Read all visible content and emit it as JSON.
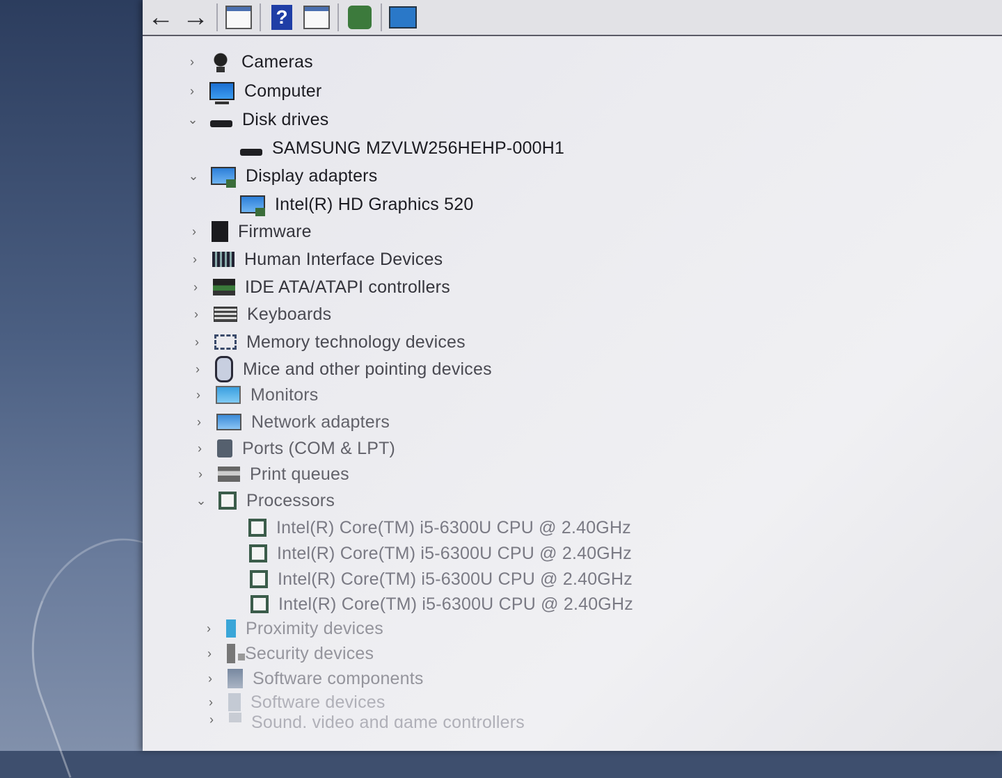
{
  "toolbar": {
    "buttons": [
      {
        "name": "back-arrow-icon",
        "glyph": "←"
      },
      {
        "name": "forward-arrow-icon",
        "glyph": "→"
      },
      {
        "name": "properties-window-icon",
        "glyph": ""
      },
      {
        "name": "help-icon",
        "glyph": "?"
      },
      {
        "name": "details-view-icon",
        "glyph": ""
      },
      {
        "name": "update-driver-icon",
        "glyph": ""
      },
      {
        "name": "scan-hardware-monitor-icon",
        "glyph": ""
      }
    ]
  },
  "tree": {
    "cameras": {
      "label": "Cameras",
      "chevron": "›",
      "icon": "camera-icon"
    },
    "computer": {
      "label": "Computer",
      "chevron": "›",
      "icon": "computer-icon"
    },
    "disk_drives": {
      "label": "Disk drives",
      "chevron": "⌄",
      "icon": "disk-drive-icon"
    },
    "disk_samsung": {
      "label": "SAMSUNG MZVLW256HEHP-000H1",
      "icon": "disk-drive-icon"
    },
    "display_adapters": {
      "label": "Display adapters",
      "chevron": "⌄",
      "icon": "display-adapter-icon"
    },
    "intel_graphics": {
      "label": "Intel(R) HD Graphics 520",
      "icon": "display-adapter-icon"
    },
    "firmware": {
      "label": "Firmware",
      "chevron": "›",
      "icon": "firmware-icon"
    },
    "hid": {
      "label": "Human Interface Devices",
      "chevron": "›",
      "icon": "hid-icon"
    },
    "ide": {
      "label": "IDE ATA/ATAPI controllers",
      "chevron": "›",
      "icon": "ide-controller-icon"
    },
    "keyboards": {
      "label": "Keyboards",
      "chevron": "›",
      "icon": "keyboard-icon"
    },
    "memory": {
      "label": "Memory technology devices",
      "chevron": "›",
      "icon": "memory-device-icon"
    },
    "mice": {
      "label": "Mice and other pointing devices",
      "chevron": "›",
      "icon": "mouse-icon"
    },
    "monitors": {
      "label": "Monitors",
      "chevron": "›",
      "icon": "monitor-icon"
    },
    "network": {
      "label": "Network adapters",
      "chevron": "›",
      "icon": "network-adapter-icon"
    },
    "ports": {
      "label": "Ports (COM & LPT)",
      "chevron": "›",
      "icon": "port-icon"
    },
    "print": {
      "label": "Print queues",
      "chevron": "›",
      "icon": "printer-icon"
    },
    "processors": {
      "label": "Processors",
      "chevron": "⌄",
      "icon": "processor-icon"
    },
    "cpu_items": [
      {
        "label": "Intel(R) Core(TM) i5-6300U CPU @ 2.40GHz"
      },
      {
        "label": "Intel(R) Core(TM) i5-6300U CPU @ 2.40GHz"
      },
      {
        "label": "Intel(R) Core(TM) i5-6300U CPU @ 2.40GHz"
      },
      {
        "label": "Intel(R) Core(TM) i5-6300U CPU @ 2.40GHz"
      }
    ],
    "proximity": {
      "label": "Proximity devices",
      "chevron": "›",
      "icon": "proximity-icon"
    },
    "security": {
      "label": "Security devices",
      "chevron": "›",
      "icon": "security-device-icon"
    },
    "software_components": {
      "label": "Software components",
      "chevron": "›",
      "icon": "software-component-icon"
    },
    "software_devices": {
      "label": "Software devices",
      "chevron": "›",
      "icon": "software-device-icon"
    },
    "sound": {
      "label": "Sound, video and game controllers",
      "chevron": "›",
      "icon": "sound-icon"
    }
  }
}
